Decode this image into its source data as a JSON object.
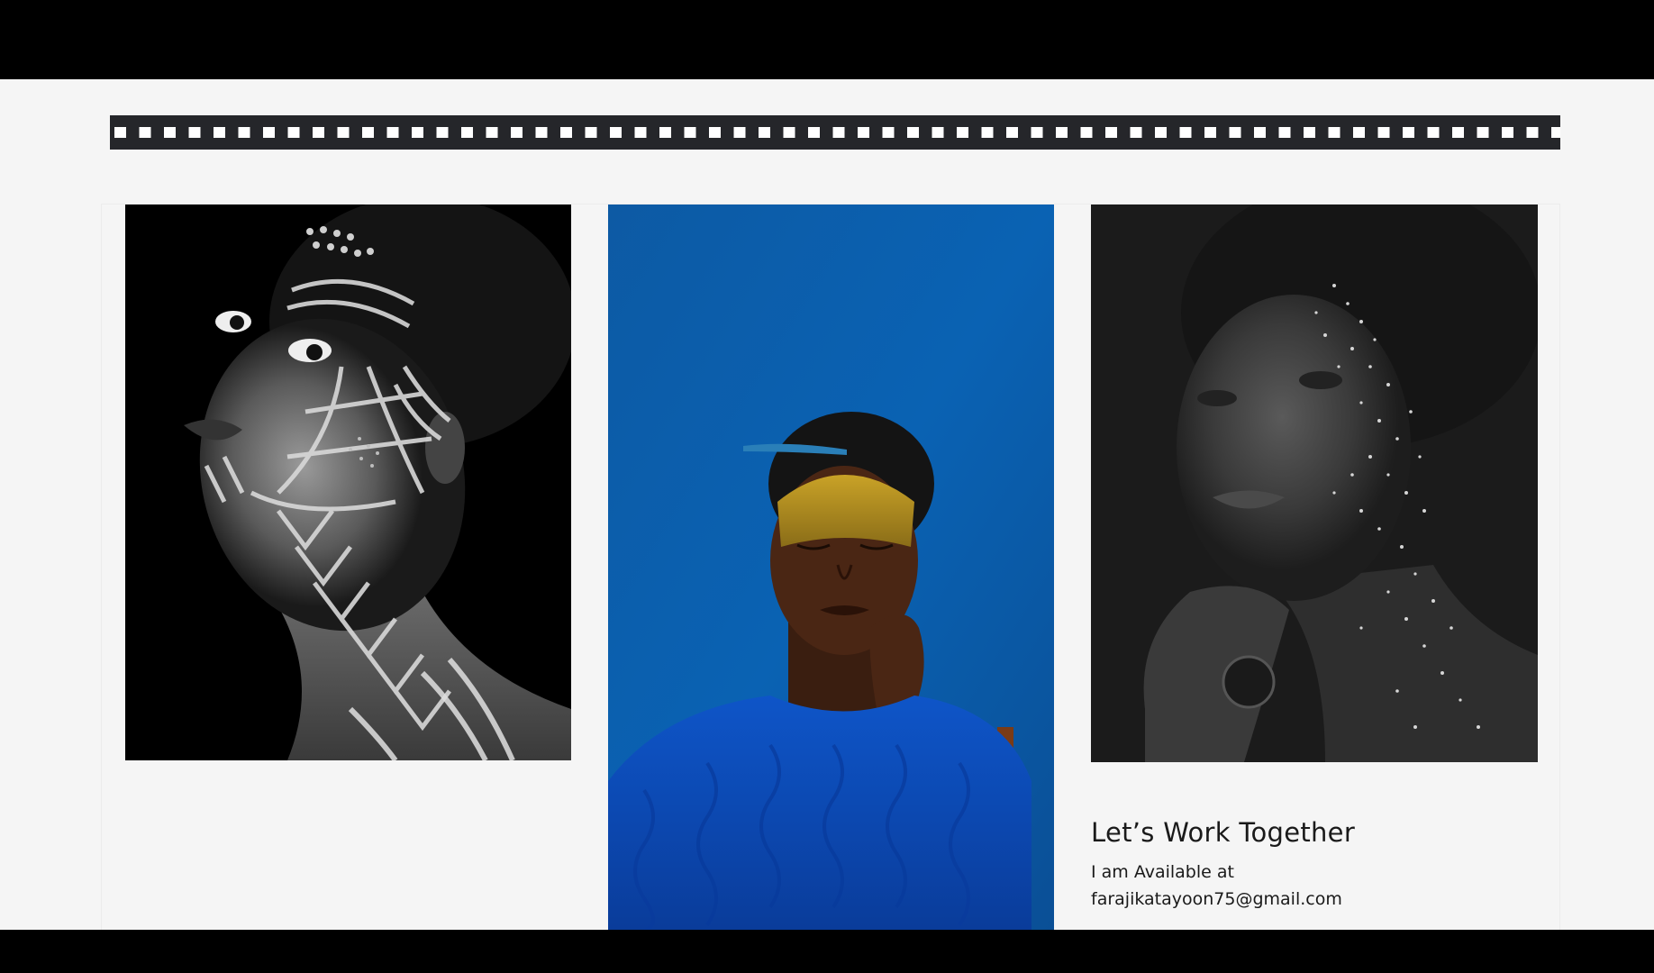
{
  "contact": {
    "title": "Let’s Work Together",
    "availability": "I am Available at",
    "email": "farajikatayoon75@gmail.com"
  },
  "gallery": {
    "photos": [
      {
        "description_icon": "portrait-bw-face-paint-image"
      },
      {
        "description_icon": "portrait-blue-sweater-gold-paint-image"
      },
      {
        "description_icon": "portrait-bw-glitter-image"
      }
    ]
  },
  "colors": {
    "film_strip": "#25262a",
    "page_background": "#f5f5f5",
    "photo2_wall": "#0a5aa8",
    "photo2_sweater": "#0b4fc0",
    "photo2_gold": "#c9a227"
  }
}
